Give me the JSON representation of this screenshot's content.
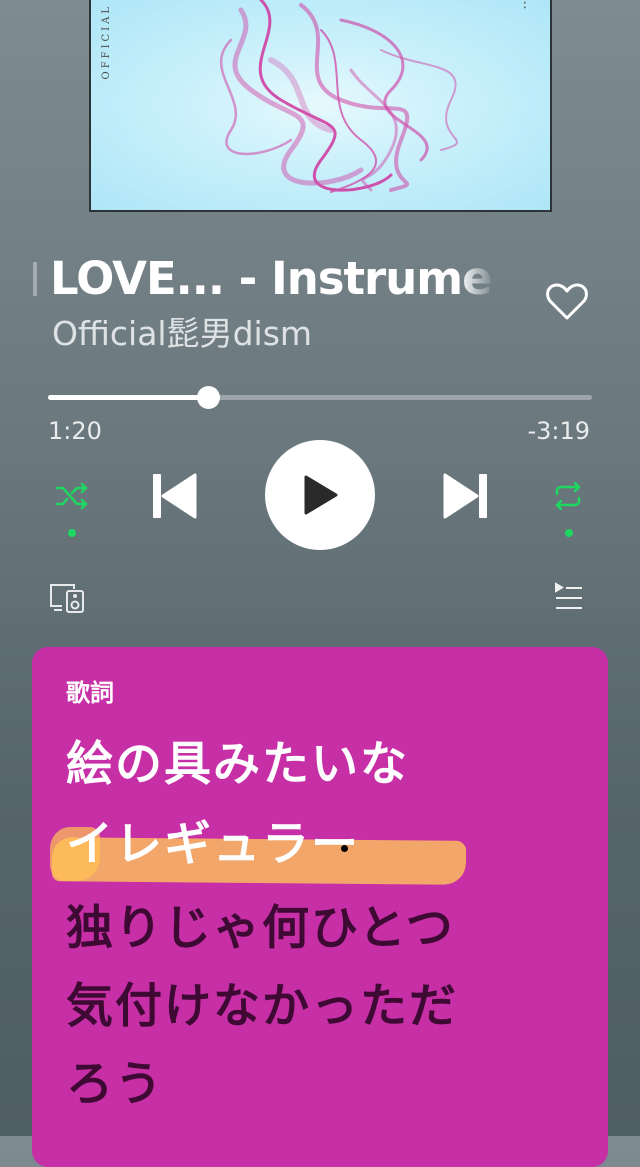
{
  "album": {
    "side_text": "OFFICIAL",
    "dots": "⋮"
  },
  "track": {
    "title": "LOVE... - Instrumental",
    "artist": "Official髭男dism"
  },
  "progress": {
    "elapsed": "1:20",
    "remaining": "-3:19",
    "fraction": 0.295
  },
  "controls": {
    "shuffle_icon": "shuffle-icon",
    "previous_icon": "skip-previous-icon",
    "play_icon": "play-icon",
    "next_icon": "skip-next-icon",
    "repeat_icon": "repeat-icon",
    "devices_icon": "devices-icon",
    "queue_icon": "queue-icon",
    "heart_icon": "heart-icon"
  },
  "colors": {
    "accent_green": "#1ed760",
    "lyrics_card": "#c72fa6",
    "lyric_upcoming": "#3e0a34"
  },
  "lyrics": {
    "heading": "歌詞",
    "lines": [
      {
        "text": "絵の具みたいな",
        "state": "past"
      },
      {
        "text": "イレギュラー",
        "state": "current"
      },
      {
        "text": "独りじゃ何ひとつ",
        "state": "upcoming"
      },
      {
        "text": "気付けなかっただ",
        "state": "upcoming"
      },
      {
        "text": "ろう",
        "state": "upcoming"
      }
    ]
  }
}
